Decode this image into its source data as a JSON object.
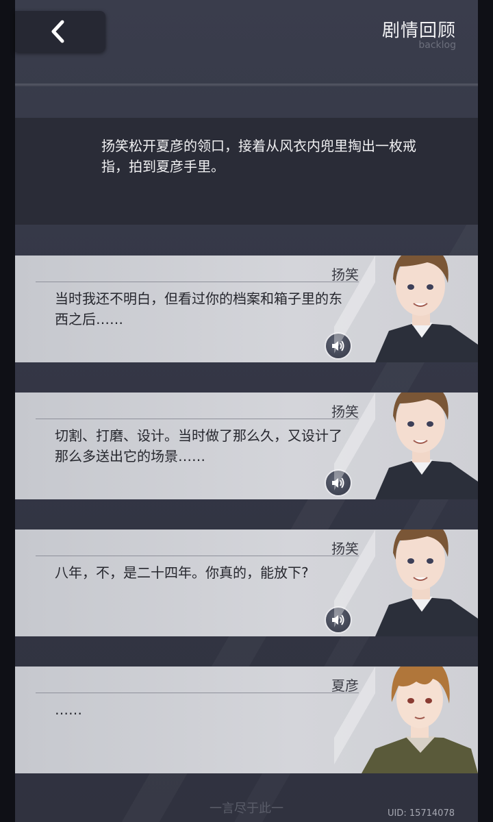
{
  "header": {
    "title": "剧情回顾",
    "subtitle": "backlog"
  },
  "narration": {
    "text": "扬笑松开夏彦的领口，接着从风衣内兜里掏出一枚戒指，拍到夏彦手里。"
  },
  "dialogues": [
    {
      "speaker": "扬笑",
      "text": "当时我还不明白，但看过你的档案和箱子里的东西之后……",
      "has_voice": true
    },
    {
      "speaker": "扬笑",
      "text": "切割、打磨、设计。当时做了那么久，又设计了那么多送出它的场景……",
      "has_voice": true
    },
    {
      "speaker": "扬笑",
      "text": "八年，不，是二十四年。你真的，能放下?",
      "has_voice": true
    },
    {
      "speaker": "夏彦",
      "text": "……",
      "has_voice": false
    }
  ],
  "footer": {
    "end_text": "一言尽于此一",
    "uid": "UID: 15714078"
  },
  "icons": {
    "back": "chevron-left-icon",
    "voice": "speaker-icon"
  }
}
